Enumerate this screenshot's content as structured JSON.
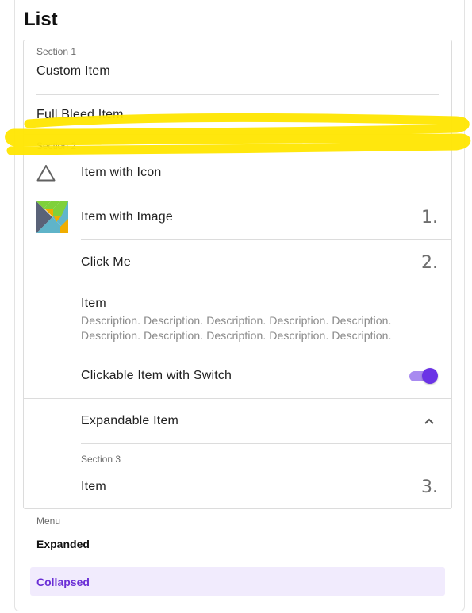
{
  "page": {
    "title": "List"
  },
  "list": {
    "section1": {
      "header": "Section 1",
      "custom_item": "Custom Item",
      "full_bleed_item": "Full Bleed Item"
    },
    "section2": {
      "header": "Section 2",
      "item_with_icon": {
        "label": "Item with Icon",
        "icon": "triangle-outline-icon"
      },
      "item_with_image": {
        "label": "Item with Image",
        "number": "1.",
        "image": "elm-tangram-logo"
      },
      "click_me": {
        "label": "Click Me",
        "number": "2."
      },
      "item_desc": {
        "label": "Item",
        "description_line1": "Description. Description. Description. Description. Description.",
        "description_line2": "Description. Description. Description. Description. Description."
      },
      "switch_item": {
        "label": "Clickable Item with Switch",
        "switch_on": true
      },
      "expandable": {
        "label": "Expandable Item",
        "icon": "chevron-up-icon"
      }
    },
    "section3": {
      "header": "Section 3",
      "item": {
        "label": "Item",
        "number": "3."
      }
    }
  },
  "menu": {
    "header": "Menu",
    "expanded": "Expanded",
    "collapsed": "Collapsed"
  },
  "colors": {
    "accent": "#6b33e6",
    "switch_track": "#a88af0",
    "selected_bg": "#f1ebfd",
    "highlighter": "#ffe600"
  }
}
